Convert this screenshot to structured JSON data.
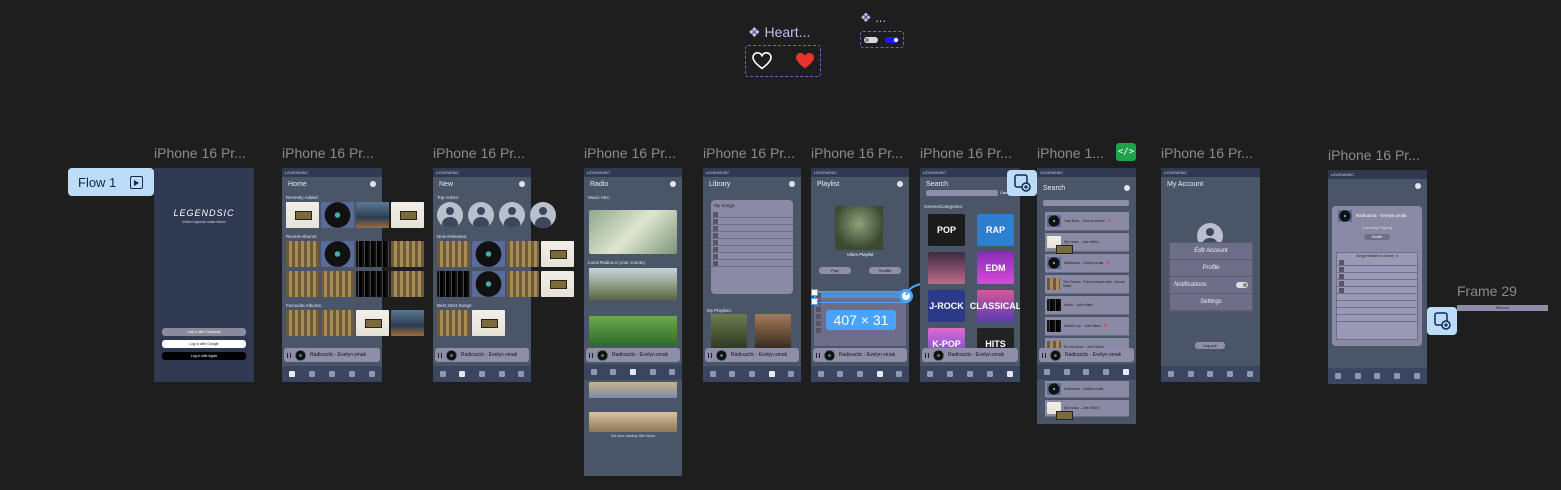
{
  "components": {
    "heart_title": "Heart...",
    "toggle_title": "...",
    "component_glyph": "❖"
  },
  "flow": {
    "label": "Flow 1"
  },
  "frames": {
    "f1_title": "iPhone 16 Pr...",
    "f2_title": "iPhone 16 Pr...",
    "f3_title": "iPhone 16 Pr...",
    "f4_title": "iPhone 16 Pr...",
    "f5_title": "iPhone 16 Pr...",
    "f6_title": "iPhone 16 Pr...",
    "f7_title": "iPhone 16 Pr...",
    "f8_title": "iPhone 1...",
    "f9_title": "iPhone 16 Pr...",
    "f10_title": "iPhone 16 Pr...",
    "frame29_title": "Frame 29"
  },
  "app": {
    "brand": "LEGENDSIC",
    "tagline": "When Legends make Music",
    "login_facebook": "Log in with Facebook",
    "login_google": "Log in with Google",
    "login_apple": "Log in with Apple",
    "now_playing": "Radioactic - Evelyn smak"
  },
  "home": {
    "title": "Home",
    "recent_added": "Recently Added:",
    "recent_albums": "Recent Albums:",
    "fav_albums": "Favourite Albums:"
  },
  "new": {
    "title": "New",
    "top_artists": "Top Artists:",
    "new_releases": "New Releases:",
    "best_songs": "Best 2024 Songs:"
  },
  "radio": {
    "title": "Radio",
    "music_hits": "Music Hits:",
    "local": "Local Radios in your country:",
    "caption": "Chilling After Hours",
    "caption2": "Get your calming Vibe Music"
  },
  "library": {
    "title": "Library",
    "my_songs": "My Songs:",
    "my_playlists": "My Playlists:"
  },
  "playlist": {
    "title": "Playlist",
    "name": "Vibes Playlist",
    "play": "Play",
    "shuffle": "Shuffle",
    "size_badge": "407 × 31"
  },
  "search": {
    "title": "Search",
    "cancel": "Cancel",
    "genres": "Genres/Categories:",
    "g1": "POP",
    "g2": "RAP",
    "g3": "",
    "g4": "EDM",
    "g5": "J-ROCK",
    "g6": "CLASSICAL",
    "g7": "K-POP",
    "g8": "HITS"
  },
  "search2": {
    "title": "Search",
    "r1": "Trap Beat - Johnny smack",
    "r2": "My music - John Mitch",
    "r3": "Radioactic - Evelyn smak",
    "r4": "The Drums - Future smack feat. Johnny Mitch",
    "r5": "Music - John Mitch",
    "r6": "Mixed it up - John Mitch",
    "r7": "By the shore - John Mitch",
    "r8": "Radioactic - Evelyn smak",
    "r9": "My music - John Mitch"
  },
  "account": {
    "title": "My Account",
    "edit": "Edit Account",
    "profile": "Profile",
    "notifications": "Notifications",
    "settings": "Settings",
    "logout": "Log out"
  },
  "nowplaying": {
    "song": "Radioactic - Evelyn smak",
    "status": "Currently Playing",
    "shuffle": "Shuffle",
    "queue_title": "Songs Related to Genre: X"
  },
  "frame29": {
    "label": "Remove"
  }
}
